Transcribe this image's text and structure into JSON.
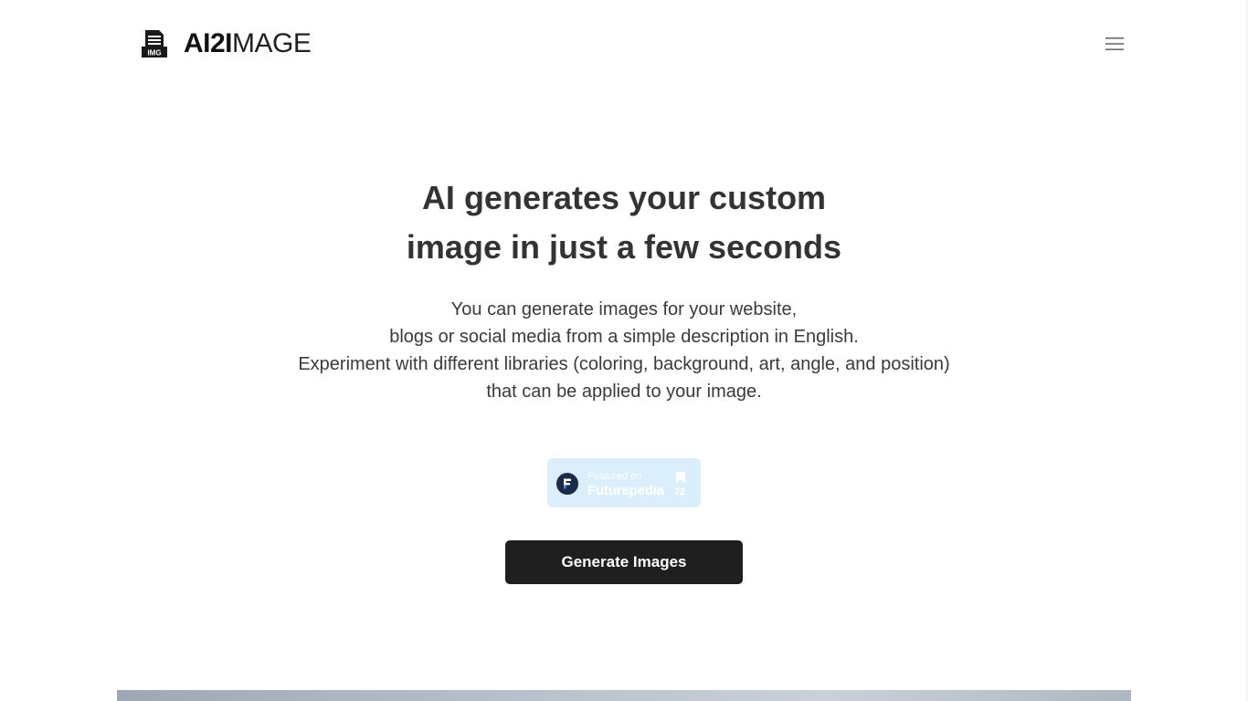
{
  "header": {
    "logo_icon": "image-file-icon",
    "logo_icon_label": "IMG",
    "logo_bold": "AI2I",
    "logo_light": "MAGE",
    "menu_icon": "hamburger-menu-icon"
  },
  "hero": {
    "title_line1": "AI generates your custom",
    "title_line2": "image in just a few seconds",
    "description": [
      "You can generate images for your website,",
      "blogs or social media from a simple description in English.",
      "Experiment with different libraries (coloring, background, art, angle, and position)",
      "that can be applied to your image."
    ]
  },
  "badge": {
    "small_text": "Featured on",
    "big_text": "Futurepedia",
    "count": "72",
    "logo_icon": "futurepedia-logo-icon",
    "bookmark_icon": "bookmark-icon"
  },
  "cta": {
    "label": "Generate Images"
  },
  "colors": {
    "cta_background": "#1f1f1f",
    "badge_background": "#dbeefb",
    "text": "#333333"
  }
}
